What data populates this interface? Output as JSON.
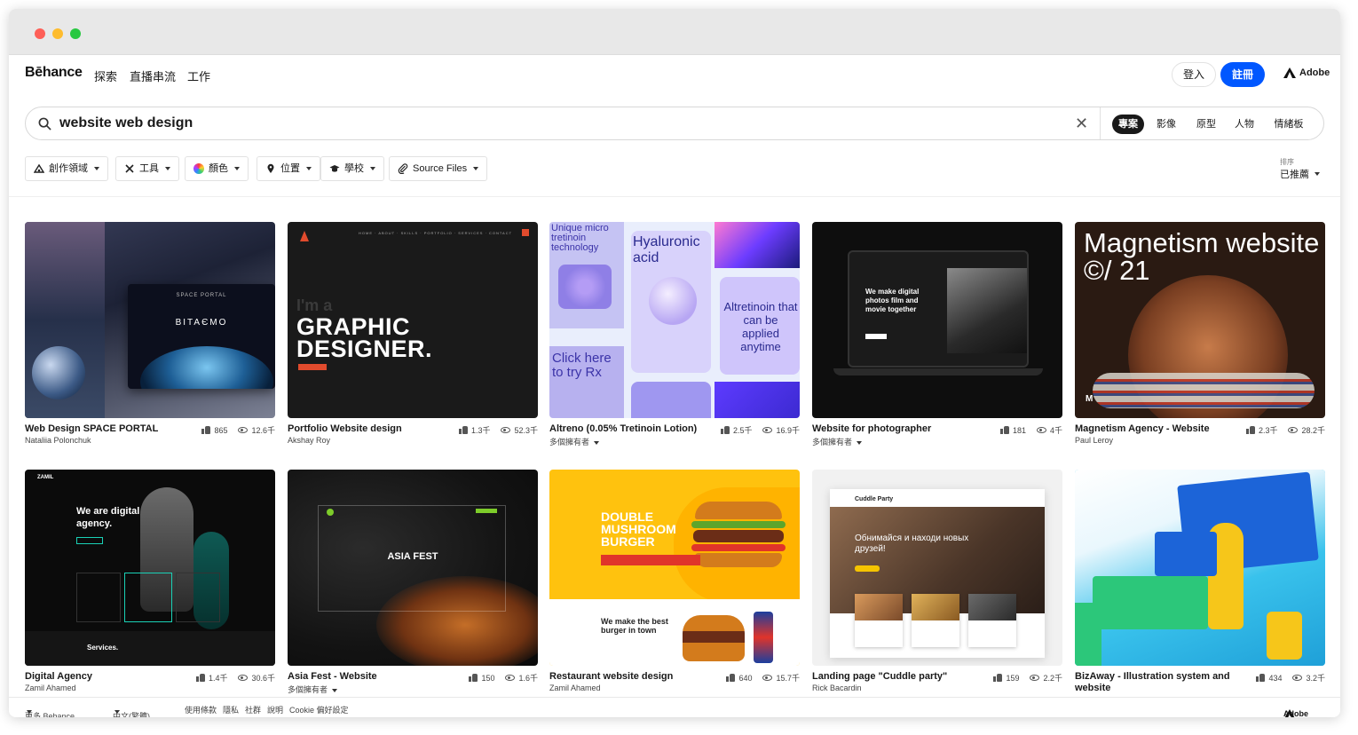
{
  "app": {
    "logo": "Bēhance"
  },
  "nav": {
    "links": [
      "探索",
      "直播串流",
      "工作"
    ],
    "login": "登入",
    "signup": "註冊",
    "adobe": "Adobe"
  },
  "search": {
    "value": "website web design",
    "scopes": [
      "專案",
      "影像",
      "原型",
      "人物",
      "情緒板"
    ],
    "active_scope": "專案"
  },
  "filters": [
    "創作領域",
    "工具",
    "顏色",
    "位置",
    "學校",
    "Source Files"
  ],
  "sort": {
    "label": "排序",
    "value": "已推薦"
  },
  "projects": [
    {
      "title": "Web Design SPACE PORTAL",
      "author": "Nataliia Polonchuk",
      "likes": "865",
      "views": "12.6千",
      "thumb_text": "BITAЄMO"
    },
    {
      "title": "Portfolio Website design",
      "author": "Akshay Roy",
      "likes": "1.3千",
      "views": "52.3千",
      "thumb_text": "GRAPHIC DESIGNER."
    },
    {
      "title": "Altreno (0.05% Tretinoin Lotion)",
      "author": "多個擁有者",
      "likes": "2.5千",
      "views": "16.9千",
      "thumb_text": "Hyaluronic acid"
    },
    {
      "title": "Website for photographer",
      "author": "多個擁有者",
      "likes": "181",
      "views": "4千",
      "thumb_text": "We make digital photos film and movie together"
    },
    {
      "title": "Magnetism Agency - Website",
      "author": "Paul Leroy",
      "likes": "2.3千",
      "views": "28.2千",
      "thumb_text": "Magnetism website ©/ 21"
    },
    {
      "title": "Digital Agency",
      "author": "Zamil Ahamed",
      "likes": "1.4千",
      "views": "30.6千",
      "thumb_text": "We are digital agency."
    },
    {
      "title": "Asia Fest - Website",
      "author": "多個擁有者",
      "likes": "150",
      "views": "1.6千",
      "thumb_text": "ASIA FEST"
    },
    {
      "title": "Restaurant website design",
      "author": "Zamil Ahamed",
      "likes": "640",
      "views": "15.7千",
      "thumb_text": "DOUBLE MUSHROOM BURGER"
    },
    {
      "title": "Landing page \"Cuddle party\"",
      "author": "Rick Bacardin",
      "likes": "159",
      "views": "2.2千",
      "thumb_text": "Обнимайся и находи новых друзей!"
    },
    {
      "title": "BizAway - Illustration system and website",
      "author": "",
      "likes": "434",
      "views": "3.2千",
      "thumb_text": ""
    }
  ],
  "thumb_extra": {
    "p1_sub": "SPACE PORTAL",
    "p2_pre": "I'm a",
    "p3_a": "Unique micro tretinoin technology",
    "p3_b": "Click here to try Rx",
    "p3_c": "Altretinoin that can be applied anytime",
    "p6_brand": "ZAMIL",
    "p6_services": "Services.",
    "p8_sub": "We make the best burger in town",
    "p9_brand": "Cuddle Party"
  },
  "footer": {
    "more": "更多 Behance",
    "lang": "中文(繁體)",
    "links": [
      "使用條款",
      "隱私",
      "社群",
      "說明",
      "Cookie 偏好設定"
    ],
    "adobe": "Adobe"
  },
  "colors": {
    "accent": "#0057ff",
    "dark": "#191919"
  }
}
